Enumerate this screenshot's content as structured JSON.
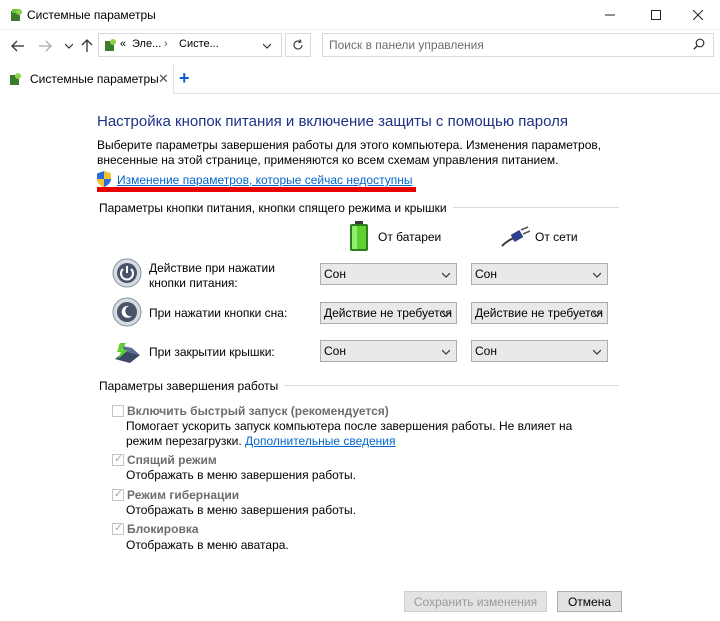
{
  "window": {
    "title": "Системные параметры",
    "controls": [
      "minimize-icon",
      "maximize-icon",
      "close-icon"
    ]
  },
  "nav": {
    "address_prefix": "«",
    "address_segments": [
      "Эле...",
      "Систе..."
    ],
    "search_placeholder": "Поиск в панели управления"
  },
  "tab": {
    "label": "Системные параметры"
  },
  "page": {
    "heading": "Настройка кнопок питания и включение защиты с помощью пароля",
    "description": "Выберите параметры завершения работы для этого компьютера. Изменения параметров, внесенные на этой странице, применяются ко всем схемам управления питанием.",
    "change_link": "Изменение параметров, которые сейчас недоступны",
    "highlight_color": "#e60000"
  },
  "power_section": {
    "title": "Параметры кнопки питания, кнопки спящего режима и крышки",
    "col_battery": "От батареи",
    "col_ac": "От сети",
    "rows": [
      {
        "label": "Действие при нажатии кнопки питания:",
        "battery": "Сон",
        "ac": "Сон"
      },
      {
        "label": "При нажатии кнопки сна:",
        "battery": "Действие не требуется",
        "ac": "Действие не требуется"
      },
      {
        "label": "При закрытии крышки:",
        "battery": "Сон",
        "ac": "Сон"
      }
    ]
  },
  "shutdown_section": {
    "title": "Параметры завершения работы",
    "options": [
      {
        "title": "Включить быстрый запуск (рекомендуется)",
        "checked": false,
        "desc": "Помогает ускорить запуск компьютера после завершения работы. Не влияет на режим перезагрузки.",
        "link": "Дополнительные сведения"
      },
      {
        "title": "Спящий режим",
        "checked": true,
        "desc": "Отображать в меню завершения работы."
      },
      {
        "title": "Режим гибернации",
        "checked": true,
        "desc": "Отображать в меню завершения работы."
      },
      {
        "title": "Блокировка",
        "checked": true,
        "desc": "Отображать в меню аватара."
      }
    ]
  },
  "footer": {
    "save": "Сохранить изменения",
    "cancel": "Отмена"
  }
}
